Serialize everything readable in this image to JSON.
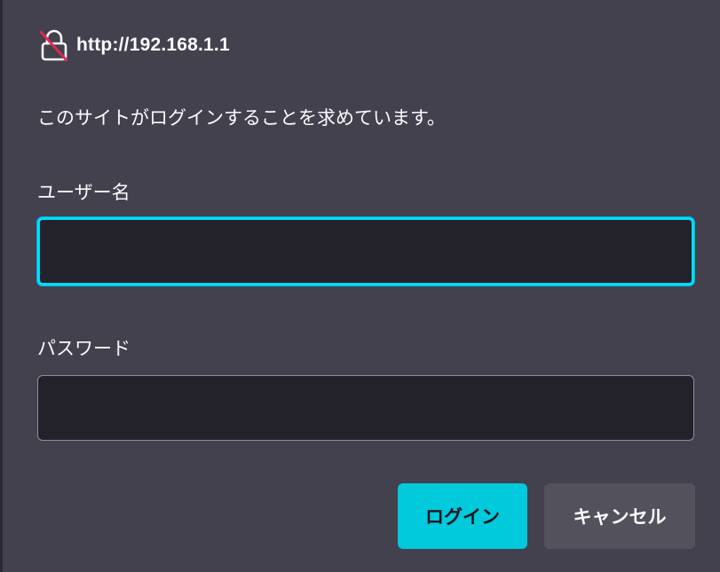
{
  "dialog": {
    "origin": "http://192.168.1.1",
    "origin_icon": "insecure-lock-icon",
    "message": "このサイトがログインすることを求めています。",
    "username": {
      "label": "ユーザー名",
      "value": "",
      "focused": true
    },
    "password": {
      "label": "パスワード",
      "value": ""
    },
    "buttons": {
      "login_label": "ログイン",
      "cancel_label": "キャンセル"
    },
    "colors": {
      "background": "#42414d",
      "accent": "#00cadb",
      "focus_ring": "#00ddff",
      "insecure_strike": "#e22850",
      "field_background": "#23222b",
      "cancel_background": "#53525c"
    }
  }
}
